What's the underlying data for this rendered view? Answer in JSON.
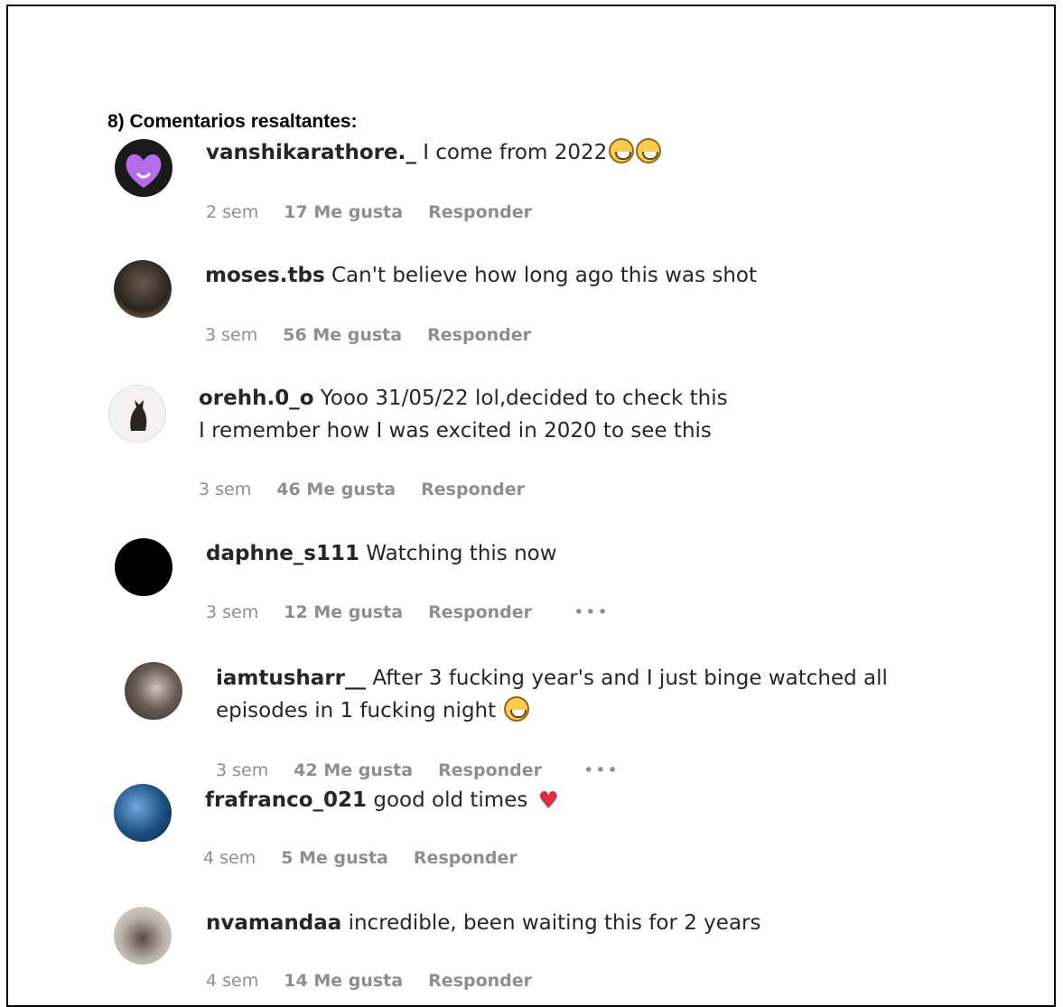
{
  "heading": "8) Comentarios resaltantes:",
  "comments": [
    {
      "user": "vanshikarathore._",
      "text": "I come from 2022",
      "emoji": "laughing-emoji x2",
      "time": "2 sem",
      "likes": "17 Me gusta",
      "reply": "Responder"
    },
    {
      "user": "moses.tbs",
      "text": "Can't believe how long ago this was shot",
      "time": "3 sem",
      "likes": "56 Me gusta",
      "reply": "Responder"
    },
    {
      "user": "orehh.0_o",
      "text": "Yooo 31/05/22 lol,decided to check this",
      "text2": "I remember how I was excited in 2020 to see this",
      "time": "3 sem",
      "likes": "46 Me gusta",
      "reply": "Responder"
    },
    {
      "user": "daphne_s111",
      "text": "Watching this now",
      "time": "3 sem",
      "likes": "12 Me gusta",
      "reply": "Responder",
      "more": "•••"
    },
    {
      "user": "iamtusharr__",
      "text": "After 3 fucking year's and I just binge watched all",
      "text2": "episodes in 1 fucking night",
      "emoji": "laughing-emoji",
      "time": "3 sem",
      "likes": "42 Me gusta",
      "reply": "Responder",
      "more": "•••"
    },
    {
      "user": "frafranco_021",
      "text": "good old times",
      "emoji": "heart-emoji",
      "time": "4 sem",
      "likes": "5 Me gusta",
      "reply": "Responder"
    },
    {
      "user": "nvamandaa",
      "text": "incredible, been waiting this for 2 years",
      "time": "4 sem",
      "likes": "14 Me gusta",
      "reply": "Responder"
    }
  ],
  "colors": {
    "username": "#262626",
    "meta": "#8e8e8e",
    "heart": "#dd2e44"
  }
}
